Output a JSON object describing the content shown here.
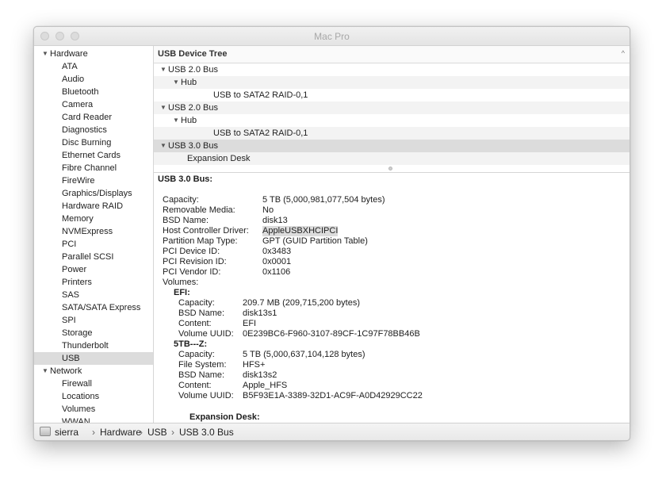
{
  "window": {
    "title": "Mac Pro"
  },
  "sidebar": {
    "hardware_label": "Hardware",
    "hardware_items": [
      "ATA",
      "Audio",
      "Bluetooth",
      "Camera",
      "Card Reader",
      "Diagnostics",
      "Disc Burning",
      "Ethernet Cards",
      "Fibre Channel",
      "FireWire",
      "Graphics/Displays",
      "Hardware RAID",
      "Memory",
      "NVMExpress",
      "PCI",
      "Parallel SCSI",
      "Power",
      "Printers",
      "SAS",
      "SATA/SATA Express",
      "SPI",
      "Storage",
      "Thunderbolt",
      "USB"
    ],
    "selected_item": "USB",
    "network_label": "Network",
    "network_items": [
      "Firewall",
      "Locations",
      "Volumes",
      "WWAN"
    ]
  },
  "tree": {
    "header": "USB Device Tree",
    "rows": [
      {
        "label": "USB 2.0 Bus",
        "level": 0,
        "expanded": true
      },
      {
        "label": "Hub",
        "level": 1,
        "expanded": true
      },
      {
        "label": "USB to SATA2 RAID-0,1",
        "level": 2
      },
      {
        "label": "USB 2.0 Bus",
        "level": 0,
        "expanded": true
      },
      {
        "label": "Hub",
        "level": 1,
        "expanded": true
      },
      {
        "label": "USB to SATA2 RAID-0,1",
        "level": 2
      },
      {
        "label": "USB 3.0 Bus",
        "level": 0,
        "expanded": true,
        "selected": true
      },
      {
        "label": "Expansion Desk",
        "level": 1
      }
    ]
  },
  "detail": {
    "title": "USB 3.0 Bus:",
    "properties": [
      {
        "key": "Capacity:",
        "value": "5 TB (5,000,981,077,504 bytes)"
      },
      {
        "key": "Removable Media:",
        "value": "No"
      },
      {
        "key": "BSD Name:",
        "value": "disk13"
      },
      {
        "key": "Host Controller Driver:",
        "value": "AppleUSBXHCIPCI",
        "highlight": true
      },
      {
        "key": "Partition Map Type:",
        "value": "GPT (GUID Partition Table)"
      },
      {
        "key": "PCI Device ID:",
        "value": "0x3483"
      },
      {
        "key": "PCI Revision ID:",
        "value": "0x0001"
      },
      {
        "key": "PCI Vendor ID:",
        "value": "0x1106"
      }
    ],
    "volumes_label": "Volumes:",
    "volumes": [
      {
        "name": "EFI:",
        "props": [
          {
            "key": "Capacity:",
            "value": "209.7 MB (209,715,200 bytes)"
          },
          {
            "key": "BSD Name:",
            "value": "disk13s1"
          },
          {
            "key": "Content:",
            "value": "EFI"
          },
          {
            "key": "Volume UUID:",
            "value": "0E239BC6-F960-3107-89CF-1C97F78BB46B"
          }
        ]
      },
      {
        "name": "5TB---Z:",
        "props": [
          {
            "key": "Capacity:",
            "value": "5 TB (5,000,637,104,128 bytes)"
          },
          {
            "key": "File System:",
            "value": "HFS+"
          },
          {
            "key": "BSD Name:",
            "value": "disk13s2"
          },
          {
            "key": "Content:",
            "value": "Apple_HFS"
          },
          {
            "key": "Volume UUID:",
            "value": "B5F93E1A-3389-32D1-AC9F-A0D42929CC22"
          }
        ]
      }
    ],
    "sub_device_title": "Expansion Desk:"
  },
  "pathbar": {
    "items": [
      "sierra",
      "Hardware",
      "USB",
      "USB 3.0 Bus"
    ],
    "separator": "›"
  },
  "icons": {
    "disclosure_open": "▼",
    "collapse_chevron": "^"
  }
}
